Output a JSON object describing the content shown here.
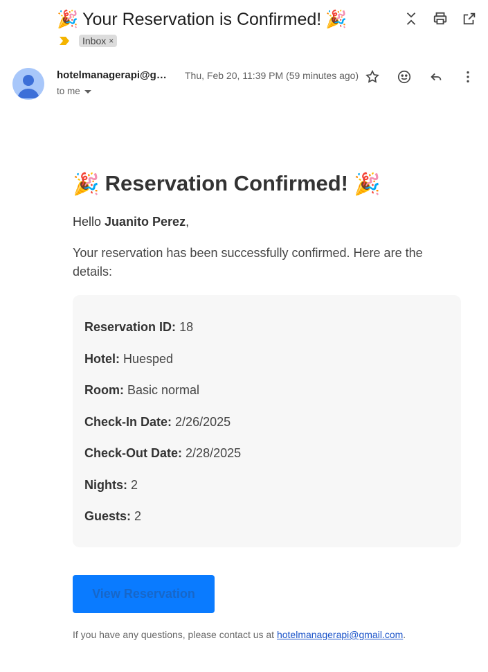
{
  "email": {
    "subject": "Your Reservation is Confirmed!",
    "labels": [
      {
        "name": "Inbox",
        "remove_glyph": "×"
      }
    ],
    "sender": "hotelmanagerapi@gmail.com",
    "timestamp": "Thu, Feb 20, 11:39 PM (59 minutes ago)",
    "recipient": "to me"
  },
  "toolbar": {
    "icons": [
      "expand-collapse-icon",
      "print-icon",
      "open-in-new-window-icon"
    ],
    "message_icons": [
      "star-icon",
      "emoji-reaction-icon",
      "reply-icon",
      "more-options-icon"
    ]
  },
  "body": {
    "heading": "Reservation Confirmed!",
    "greeting_prefix": "Hello ",
    "guest_name": "Juanito Perez",
    "greeting_suffix": ",",
    "intro": "Your reservation has been successfully confirmed. Here are the details:",
    "details": [
      {
        "label": "Reservation ID:",
        "value": "18"
      },
      {
        "label": "Hotel:",
        "value": "Huesped"
      },
      {
        "label": "Room:",
        "value": "Basic normal"
      },
      {
        "label": "Check-In Date:",
        "value": "2/26/2025"
      },
      {
        "label": "Check-Out Date:",
        "value": "2/28/2025"
      },
      {
        "label": "Nights:",
        "value": "2"
      },
      {
        "label": "Guests:",
        "value": "2"
      }
    ],
    "button_label": "View Reservation",
    "footer_prefix": "If you have any questions, please contact us at ",
    "footer_email": "hotelmanagerapi@gmail.com",
    "footer_suffix": "."
  },
  "colors": {
    "button_bg": "#0a7bff",
    "details_bg": "#f7f7f7",
    "avatar_bg": "#a8c7fa",
    "link": "#1a53c9"
  }
}
